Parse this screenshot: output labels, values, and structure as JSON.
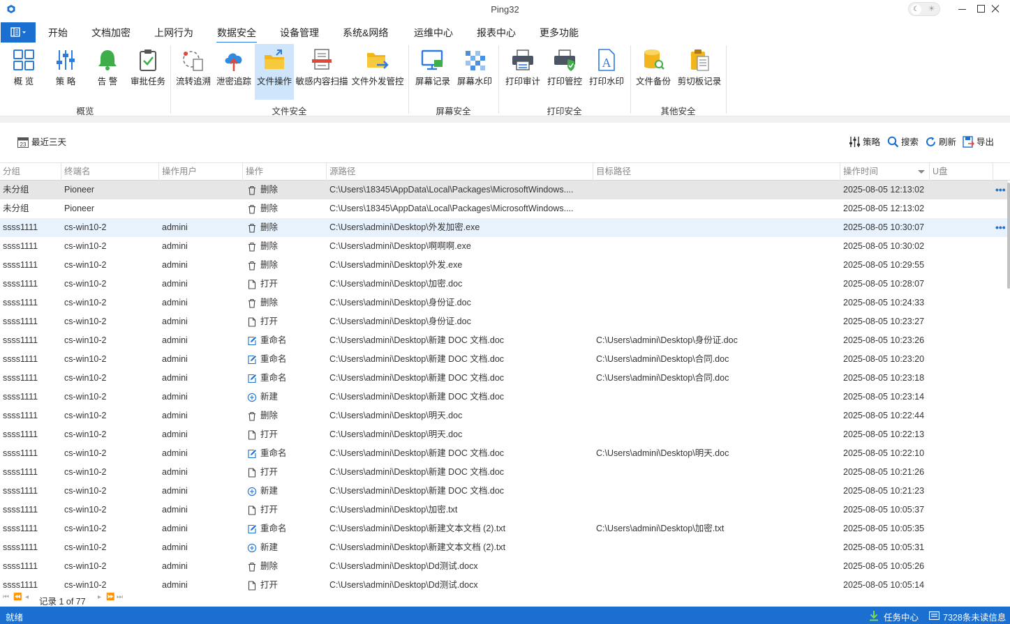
{
  "window": {
    "title": "Ping32"
  },
  "menu": {
    "tabs": [
      {
        "label": "开始"
      },
      {
        "label": "文档加密"
      },
      {
        "label": "上网行为"
      },
      {
        "label": "数据安全",
        "active": true
      },
      {
        "label": "设备管理"
      },
      {
        "label": "系统&网络"
      },
      {
        "label": "运维中心"
      },
      {
        "label": "报表中心"
      },
      {
        "label": "更多功能"
      }
    ]
  },
  "ribbon": {
    "groups": [
      "概览",
      "文件安全",
      "屏幕安全",
      "打印安全",
      "其他安全"
    ],
    "buttons": [
      {
        "label": "概 览",
        "icon": "overview-grid-icon"
      },
      {
        "label": "策 略",
        "icon": "policy-sliders-icon"
      },
      {
        "label": "告 警",
        "icon": "alarm-bell-icon"
      },
      {
        "label": "审批任务",
        "icon": "approval-clipboard-icon"
      },
      {
        "label": "流转追溯",
        "icon": "flow-trace-icon"
      },
      {
        "label": "泄密追踪",
        "icon": "leak-cloud-icon"
      },
      {
        "label": "文件操作",
        "icon": "file-operation-folder-icon",
        "active": true
      },
      {
        "label": "敏感内容扫描",
        "icon": "sensitive-scan-icon"
      },
      {
        "label": "文件外发管控",
        "icon": "file-outgoing-icon"
      },
      {
        "label": "屏幕记录",
        "icon": "screen-record-icon"
      },
      {
        "label": "屏幕水印",
        "icon": "screen-watermark-icon"
      },
      {
        "label": "打印审计",
        "icon": "print-audit-icon"
      },
      {
        "label": "打印管控",
        "icon": "print-control-icon"
      },
      {
        "label": "打印水印",
        "icon": "print-watermark-icon"
      },
      {
        "label": "文件备份",
        "icon": "file-backup-icon"
      },
      {
        "label": "剪切板记录",
        "icon": "clipboard-record-icon"
      }
    ]
  },
  "toolbar": {
    "date_range": "最近三天",
    "date_icon_day": "23",
    "policy": "策略",
    "search": "搜索",
    "refresh": "刷新",
    "export": "导出"
  },
  "table": {
    "columns": [
      "分组",
      "终端名",
      "操作用户",
      "操作",
      "源路径",
      "目标路径",
      "操作时间",
      "U盘"
    ],
    "sort_column": "操作时间",
    "rows": [
      {
        "group": "未分组",
        "terminal": "Pioneer",
        "user": "",
        "op": "删除",
        "op_icon": "trash-icon",
        "src": "C:\\Users\\18345\\AppData\\Local\\Packages\\MicrosoftWindows....",
        "dst": "",
        "time": "2025-08-05 12:13:02",
        "state": "selected",
        "more": true
      },
      {
        "group": "未分组",
        "terminal": "Pioneer",
        "user": "",
        "op": "删除",
        "op_icon": "trash-icon",
        "src": "C:\\Users\\18345\\AppData\\Local\\Packages\\MicrosoftWindows....",
        "dst": "",
        "time": "2025-08-05 12:13:02"
      },
      {
        "group": "ssss1111",
        "terminal": "cs-win10-2",
        "user": "admini",
        "op": "删除",
        "op_icon": "trash-icon",
        "src": "C:\\Users\\admini\\Desktop\\外发加密.exe",
        "dst": "",
        "time": "2025-08-05 10:30:07",
        "state": "hover",
        "more": true
      },
      {
        "group": "ssss1111",
        "terminal": "cs-win10-2",
        "user": "admini",
        "op": "删除",
        "op_icon": "trash-icon",
        "src": "C:\\Users\\admini\\Desktop\\啊啊啊.exe",
        "dst": "",
        "time": "2025-08-05 10:30:02"
      },
      {
        "group": "ssss1111",
        "terminal": "cs-win10-2",
        "user": "admini",
        "op": "删除",
        "op_icon": "trash-icon",
        "src": "C:\\Users\\admini\\Desktop\\外发.exe",
        "dst": "",
        "time": "2025-08-05 10:29:55"
      },
      {
        "group": "ssss1111",
        "terminal": "cs-win10-2",
        "user": "admini",
        "op": "打开",
        "op_icon": "file-open-icon",
        "src": "C:\\Users\\admini\\Desktop\\加密.doc",
        "dst": "",
        "time": "2025-08-05 10:28:07"
      },
      {
        "group": "ssss1111",
        "terminal": "cs-win10-2",
        "user": "admini",
        "op": "删除",
        "op_icon": "trash-icon",
        "src": "C:\\Users\\admini\\Desktop\\身份证.doc",
        "dst": "",
        "time": "2025-08-05 10:24:33"
      },
      {
        "group": "ssss1111",
        "terminal": "cs-win10-2",
        "user": "admini",
        "op": "打开",
        "op_icon": "file-open-icon",
        "src": "C:\\Users\\admini\\Desktop\\身份证.doc",
        "dst": "",
        "time": "2025-08-05 10:23:27"
      },
      {
        "group": "ssss1111",
        "terminal": "cs-win10-2",
        "user": "admini",
        "op": "重命名",
        "op_icon": "rename-icon",
        "src": "C:\\Users\\admini\\Desktop\\新建 DOC 文档.doc",
        "dst": "C:\\Users\\admini\\Desktop\\身份证.doc",
        "time": "2025-08-05 10:23:26"
      },
      {
        "group": "ssss1111",
        "terminal": "cs-win10-2",
        "user": "admini",
        "op": "重命名",
        "op_icon": "rename-icon",
        "src": "C:\\Users\\admini\\Desktop\\新建 DOC 文档.doc",
        "dst": "C:\\Users\\admini\\Desktop\\合同.doc",
        "time": "2025-08-05 10:23:20"
      },
      {
        "group": "ssss1111",
        "terminal": "cs-win10-2",
        "user": "admini",
        "op": "重命名",
        "op_icon": "rename-icon",
        "src": "C:\\Users\\admini\\Desktop\\新建 DOC 文档.doc",
        "dst": "C:\\Users\\admini\\Desktop\\合同.doc",
        "time": "2025-08-05 10:23:18"
      },
      {
        "group": "ssss1111",
        "terminal": "cs-win10-2",
        "user": "admini",
        "op": "新建",
        "op_icon": "plus-circle-icon",
        "src": "C:\\Users\\admini\\Desktop\\新建 DOC 文档.doc",
        "dst": "",
        "time": "2025-08-05 10:23:14"
      },
      {
        "group": "ssss1111",
        "terminal": "cs-win10-2",
        "user": "admini",
        "op": "删除",
        "op_icon": "trash-icon",
        "src": "C:\\Users\\admini\\Desktop\\明天.doc",
        "dst": "",
        "time": "2025-08-05 10:22:44"
      },
      {
        "group": "ssss1111",
        "terminal": "cs-win10-2",
        "user": "admini",
        "op": "打开",
        "op_icon": "file-open-icon",
        "src": "C:\\Users\\admini\\Desktop\\明天.doc",
        "dst": "",
        "time": "2025-08-05 10:22:13"
      },
      {
        "group": "ssss1111",
        "terminal": "cs-win10-2",
        "user": "admini",
        "op": "重命名",
        "op_icon": "rename-icon",
        "src": "C:\\Users\\admini\\Desktop\\新建 DOC 文档.doc",
        "dst": "C:\\Users\\admini\\Desktop\\明天.doc",
        "time": "2025-08-05 10:22:10"
      },
      {
        "group": "ssss1111",
        "terminal": "cs-win10-2",
        "user": "admini",
        "op": "打开",
        "op_icon": "file-open-icon",
        "src": "C:\\Users\\admini\\Desktop\\新建 DOC 文档.doc",
        "dst": "",
        "time": "2025-08-05 10:21:26"
      },
      {
        "group": "ssss1111",
        "terminal": "cs-win10-2",
        "user": "admini",
        "op": "新建",
        "op_icon": "plus-circle-icon",
        "src": "C:\\Users\\admini\\Desktop\\新建 DOC 文档.doc",
        "dst": "",
        "time": "2025-08-05 10:21:23"
      },
      {
        "group": "ssss1111",
        "terminal": "cs-win10-2",
        "user": "admini",
        "op": "打开",
        "op_icon": "file-open-icon",
        "src": "C:\\Users\\admini\\Desktop\\加密.txt",
        "dst": "",
        "time": "2025-08-05 10:05:37"
      },
      {
        "group": "ssss1111",
        "terminal": "cs-win10-2",
        "user": "admini",
        "op": "重命名",
        "op_icon": "rename-icon",
        "src": "C:\\Users\\admini\\Desktop\\新建文本文档 (2).txt",
        "dst": "C:\\Users\\admini\\Desktop\\加密.txt",
        "time": "2025-08-05 10:05:35"
      },
      {
        "group": "ssss1111",
        "terminal": "cs-win10-2",
        "user": "admini",
        "op": "新建",
        "op_icon": "plus-circle-icon",
        "src": "C:\\Users\\admini\\Desktop\\新建文本文档 (2).txt",
        "dst": "",
        "time": "2025-08-05 10:05:31"
      },
      {
        "group": "ssss1111",
        "terminal": "cs-win10-2",
        "user": "admini",
        "op": "删除",
        "op_icon": "trash-icon",
        "src": "C:\\Users\\admini\\Desktop\\Dd测试.docx",
        "dst": "",
        "time": "2025-08-05 10:05:26"
      },
      {
        "group": "ssss1111",
        "terminal": "cs-win10-2",
        "user": "admini",
        "op": "打开",
        "op_icon": "file-open-icon",
        "src": "C:\\Users\\admini\\Desktop\\Dd测试.docx",
        "dst": "",
        "time": "2025-08-05 10:05:14"
      }
    ]
  },
  "pager": {
    "text": "记录 1 of 77"
  },
  "status": {
    "ready": "就绪",
    "task_center": "任务中心",
    "unread": "7328条未读信息"
  },
  "colors": {
    "accent": "#1a6fd1",
    "tab_underline": "#2d7be0",
    "active_button_bg": "#cfe5fb",
    "selected_row_bg": "#e6e6e6",
    "hover_row_bg": "#e8f2fc"
  }
}
